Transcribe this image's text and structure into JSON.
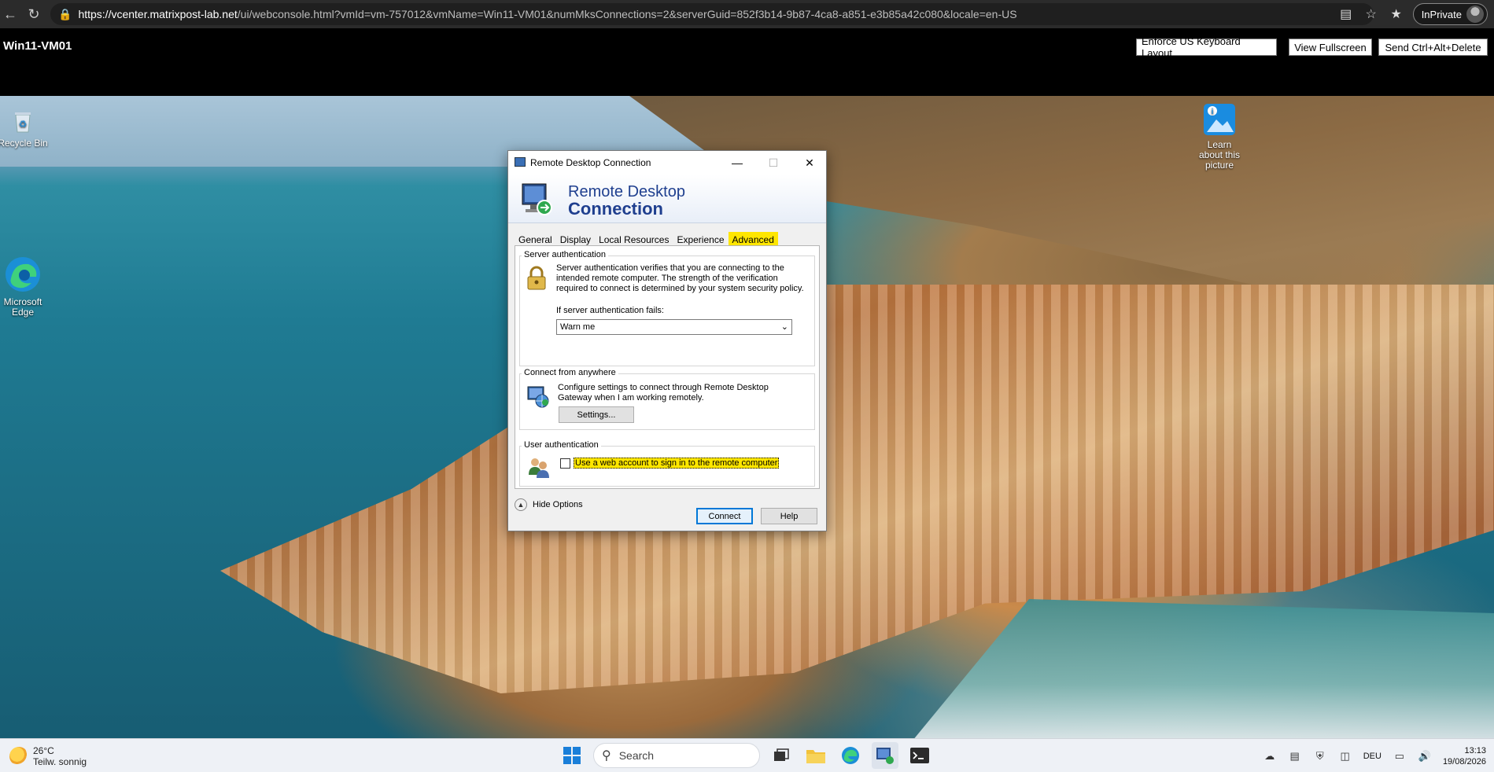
{
  "browser": {
    "url_host": "https://vcenter.matrixpost-lab.net",
    "url_rest": "/ui/webconsole.html?vmId=vm-757012&vmName=Win11-VM01&numMksConnections=2&serverGuid=852f3b14-9b87-4ca8-a851-e3b85a42c080&locale=en-US",
    "inprivate_label": "InPrivate"
  },
  "console": {
    "vm_name": "Win11-VM01",
    "buttons": {
      "keyboard": "Enforce US Keyboard Layout",
      "fullscreen": "View Fullscreen",
      "ctrl_alt_del": "Send Ctrl+Alt+Delete"
    }
  },
  "desktop": {
    "icons": {
      "recycle_bin": "Recycle Bin",
      "edge": "Microsoft Edge",
      "learn_picture": "Learn about this picture"
    }
  },
  "rdc": {
    "window_title": "Remote Desktop Connection",
    "banner_line1": "Remote Desktop",
    "banner_line2": "Connection",
    "tabs": [
      "General",
      "Display",
      "Local Resources",
      "Experience",
      "Advanced"
    ],
    "active_tab": "Advanced",
    "server_auth": {
      "label": "Server authentication",
      "description": "Server authentication verifies that you are connecting to the intended remote computer. The strength of the verification required to connect is determined by your system security policy.",
      "fail_label": "If server authentication fails:",
      "fail_value": "Warn me"
    },
    "connect_anywhere": {
      "label": "Connect from anywhere",
      "description": "Configure settings to connect through Remote Desktop Gateway when I am working remotely.",
      "settings_button": "Settings..."
    },
    "user_auth": {
      "label": "User authentication",
      "checkbox_label": "Use a web account to sign in to the remote computer",
      "checked": false
    },
    "hide_options": "Hide Options",
    "connect_button": "Connect",
    "help_button": "Help"
  },
  "taskbar": {
    "weather_temp": "26°C",
    "weather_desc": "Teilw. sonnig",
    "search_placeholder": "Search",
    "language": "DEU",
    "time": "13:13",
    "date": "19/08/2026"
  },
  "colors": {
    "highlight": "#ffe600",
    "rdc_blue": "#1f3f8f",
    "taskbar": "#eef1f6"
  }
}
